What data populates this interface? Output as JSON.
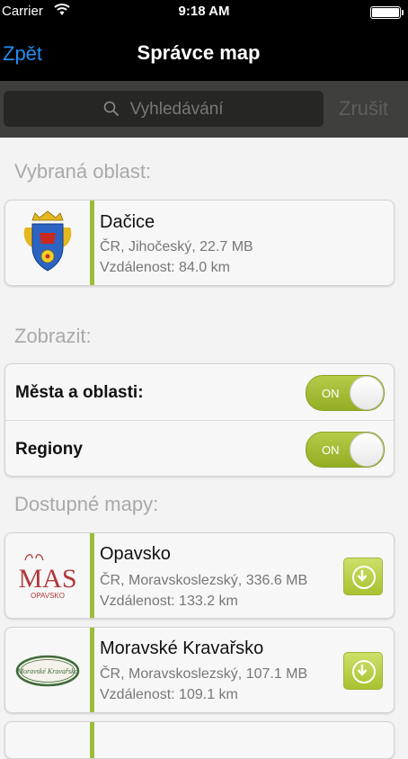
{
  "status_bar": {
    "carrier": "Carrier",
    "time": "9:18 AM"
  },
  "nav": {
    "back_label": "Zpět",
    "title": "Správce map"
  },
  "search": {
    "placeholder": "Vyhledávání",
    "cancel_label": "Zrušit"
  },
  "selected_area": {
    "section_title": "Vybraná oblast:",
    "item": {
      "name": "Dačice",
      "details": "ČR, Jihočeský, 22.7 MB",
      "distance": "Vzdálenost: 84.0 km"
    }
  },
  "display": {
    "section_title": "Zobrazit:",
    "toggles": [
      {
        "label": "Města a oblasti:",
        "state": "ON",
        "on": true
      },
      {
        "label": "Regiony",
        "state": "ON",
        "on": true
      }
    ]
  },
  "available_maps": {
    "section_title": "Dostupné mapy:",
    "items": [
      {
        "name": "Opavsko",
        "details": "ČR, Moravskoslezský, 336.6 MB",
        "distance": "Vzdálenost: 133.2 km",
        "logo_text": "MAS",
        "logo_subtext": "OPAVSKO"
      },
      {
        "name": "Moravské Kravařsko",
        "details": "ČR, Moravskoslezský, 107.1 MB",
        "distance": "Vzdálenost: 109.1 km",
        "logo_text": "Moravské Kravařsko"
      }
    ]
  },
  "colors": {
    "accent": "#9bbd3a",
    "link": "#1f8ff5",
    "nav_bg": "#000000",
    "search_bg": "#3f3f3c"
  }
}
